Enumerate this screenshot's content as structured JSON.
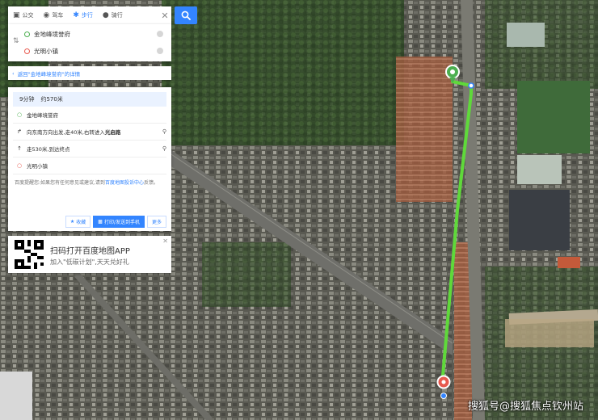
{
  "modes": {
    "transit": "公交",
    "drive": "驾车",
    "walk": "步行",
    "ride": "骑行"
  },
  "route": {
    "start": "金地峰境誉府",
    "end": "光明小镇"
  },
  "back_link": "返回\"金地峰境誉府\"的详情",
  "summary": {
    "time": "9分钟",
    "distance": "约570米"
  },
  "steps": [
    {
      "text": "金地峰境誉府"
    },
    {
      "text_plain": "向东南方向出发,走40米,右转进入",
      "text_bold": "光启路"
    },
    {
      "text": "走530米,到达终点"
    },
    {
      "text": "光明小镇"
    }
  ],
  "feedback": {
    "text": "百度提醒您:如果您有任何意见或建议,请到",
    "link": "百度地图投诉中心",
    "suffix": "反馈。"
  },
  "actions": {
    "favorite": "收藏",
    "send_to_phone": "打印/发送到手机",
    "more": "更多"
  },
  "ad": {
    "title": "扫码打开百度地图APP",
    "subtitle": "加入\"低碳计划\",天天兑好礼"
  },
  "watermark": "搜狐号@搜狐焦点钦州站",
  "colors": {
    "accent": "#3385ff",
    "route": "#5fd93a",
    "start_dot": "#4caf50",
    "end_dot": "#e85a4f"
  }
}
